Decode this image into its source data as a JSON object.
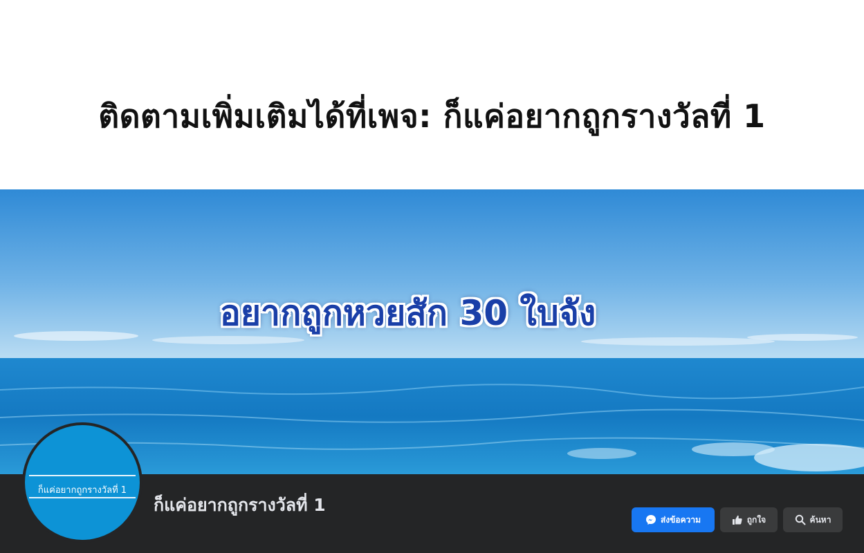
{
  "headline": "ติดตามเพิ่มเติมได้ที่เพจ: ก็แค่อยากถูกรางวัลที่ 1",
  "cover": {
    "caption": "อยากถูกหวยสัก 30 ใบจัง"
  },
  "profile": {
    "avatar_text": "ก็แค่อยากถูกรางวัลที่ 1",
    "page_name": "ก็แค่อยากถูกรางวัลที่ 1"
  },
  "actions": {
    "message_label": "ส่งข้อความ",
    "like_label": "ถูกใจ",
    "search_label": "ค้นหา"
  },
  "icons": {
    "message": "messenger-icon",
    "like": "thumbs-up-icon",
    "search": "search-icon"
  },
  "colors": {
    "accent": "#1877f2",
    "profile_bar": "#242526",
    "secondary_button": "#3a3b3c",
    "avatar_bg": "#0d93d6",
    "caption": "#1a3fa8"
  }
}
